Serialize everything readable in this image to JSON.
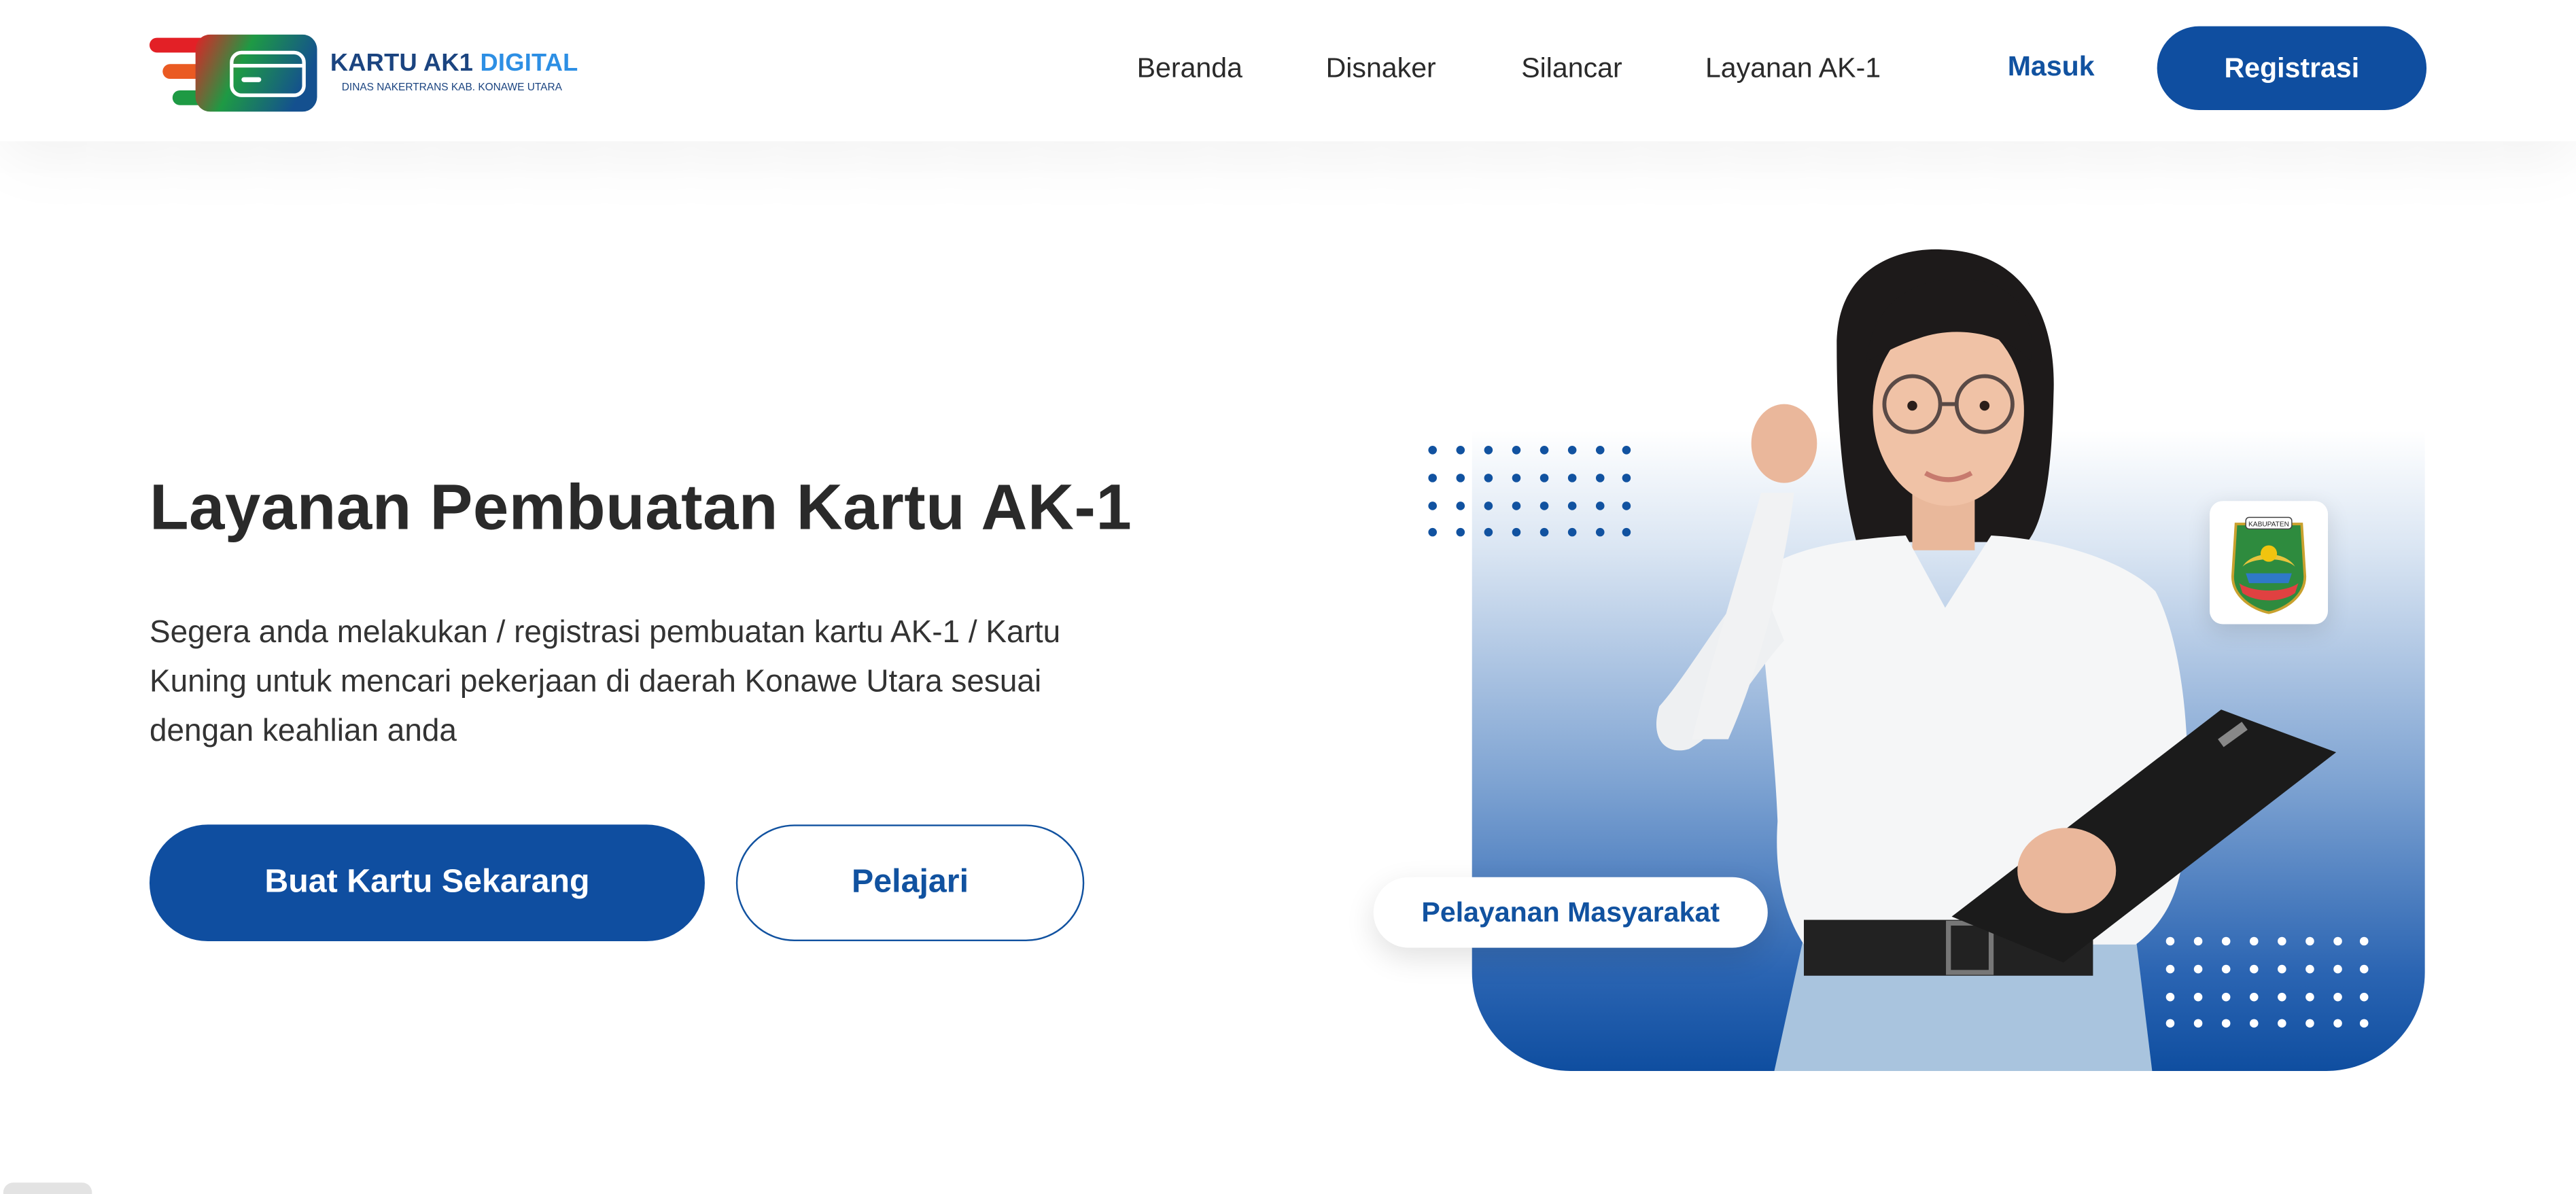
{
  "header": {
    "logo": {
      "title_main": "KARTU AK1",
      "title_accent": "DIGITAL",
      "subtitle": "DINAS NAKERTRANS KAB. KONAWE UTARA"
    },
    "nav": [
      {
        "label": "Beranda"
      },
      {
        "label": "Disnaker"
      },
      {
        "label": "Silancar"
      },
      {
        "label": "Layanan AK-1"
      }
    ],
    "login_label": "Masuk",
    "register_label": "Registrasi"
  },
  "hero": {
    "title": "Layanan Pembuatan Kartu AK-1",
    "description": "Segera anda melakukan / registrasi pembuatan kartu AK-1 / Kartu Kuning untuk mencari pekerjaan di daerah Konawe Utara sesuai dengan keahlian anda",
    "primary_button": "Buat Kartu Sekarang",
    "secondary_button": "Pelajari",
    "badge": "Pelayanan Masyarakat",
    "emblem_text": "KABUPATEN"
  },
  "colors": {
    "brand_blue": "#0f4ea0",
    "accent_blue": "#2d8fe4",
    "logo_red": "#e32026",
    "logo_green": "#1e9a44"
  },
  "icons": {
    "logo": "card-logo-icon",
    "emblem": "regency-emblem-icon"
  }
}
